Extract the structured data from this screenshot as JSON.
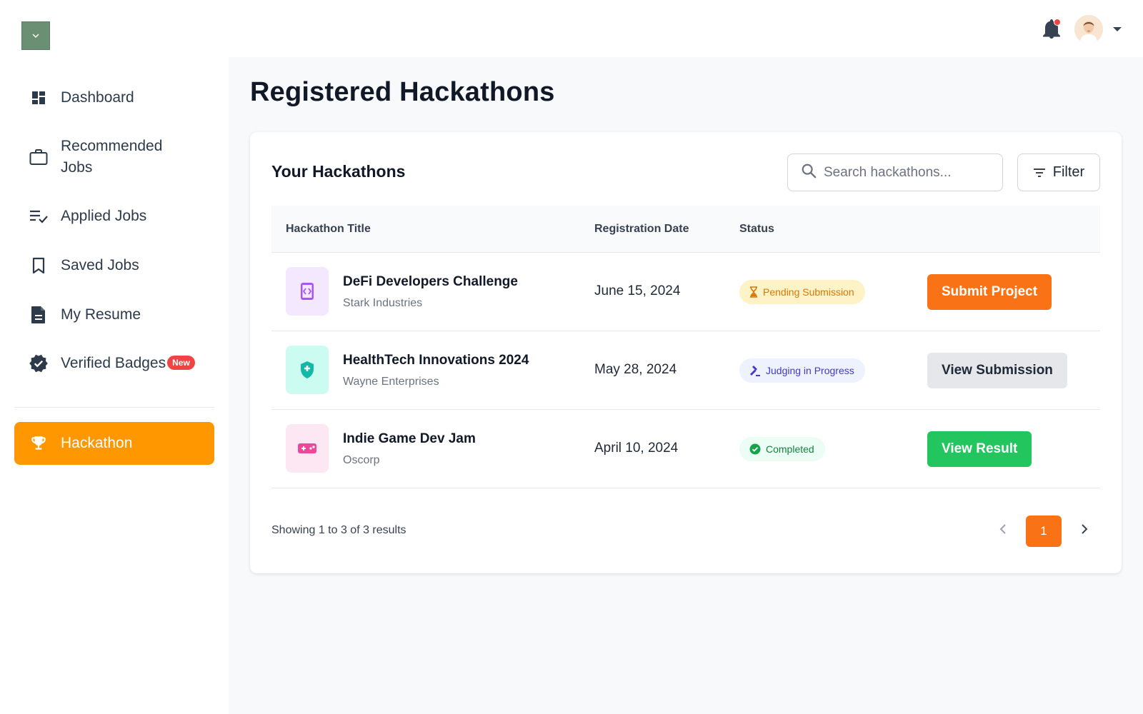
{
  "header": {
    "notification_icon": "bell-icon",
    "has_notification": true,
    "avatar_icon": "user-avatar",
    "menu_icon": "caret-down-icon"
  },
  "sidebar": {
    "items": [
      {
        "label": "Dashboard",
        "icon": "dashboard-icon"
      },
      {
        "label": "Recommended Jobs",
        "icon": "briefcase-icon"
      },
      {
        "label": "Applied Jobs",
        "icon": "checklist-icon"
      },
      {
        "label": "Saved Jobs",
        "icon": "bookmark-icon"
      },
      {
        "label": "My Resume",
        "icon": "document-icon"
      },
      {
        "label": "Verified Badges",
        "icon": "verified-icon",
        "badge": "New"
      },
      {
        "label": "Hackathon",
        "icon": "trophy-icon",
        "active": true
      }
    ]
  },
  "page": {
    "title": "Registered Hackathons"
  },
  "card": {
    "title": "Your Hackathons",
    "search_placeholder": "Search hackathons...",
    "filter_label": "Filter",
    "columns": [
      "Hackathon Title",
      "Registration Date",
      "Status"
    ],
    "rows": [
      {
        "title": "DeFi Developers Challenge",
        "org": "Stark Industries",
        "date": "June 15, 2024",
        "status": "Pending Submission",
        "status_icon": "hourglass-icon",
        "action": "Submit Project",
        "icon": "code-icon"
      },
      {
        "title": "HealthTech Innovations 2024",
        "org": "Wayne Enterprises",
        "date": "May 28, 2024",
        "status": "Judging in Progress",
        "status_icon": "gavel-icon",
        "action": "View Submission",
        "icon": "health-shield-icon"
      },
      {
        "title": "Indie Game Dev Jam",
        "org": "Oscorp",
        "date": "April 10, 2024",
        "status": "Completed",
        "status_icon": "check-circle-icon",
        "action": "View Result",
        "icon": "gamepad-icon"
      }
    ],
    "results_text": "Showing 1 to 3 of 3 results",
    "current_page": "1"
  },
  "colors": {
    "accent": "#ff9800",
    "primary_button": "#f97316",
    "success": "#22c55e",
    "pending_bg": "#fef3c7",
    "pending_text": "#d97706",
    "judging_bg": "#eef2ff",
    "judging_text": "#4338ca",
    "completed_bg": "#ecfdf5",
    "completed_text": "#15803d"
  }
}
